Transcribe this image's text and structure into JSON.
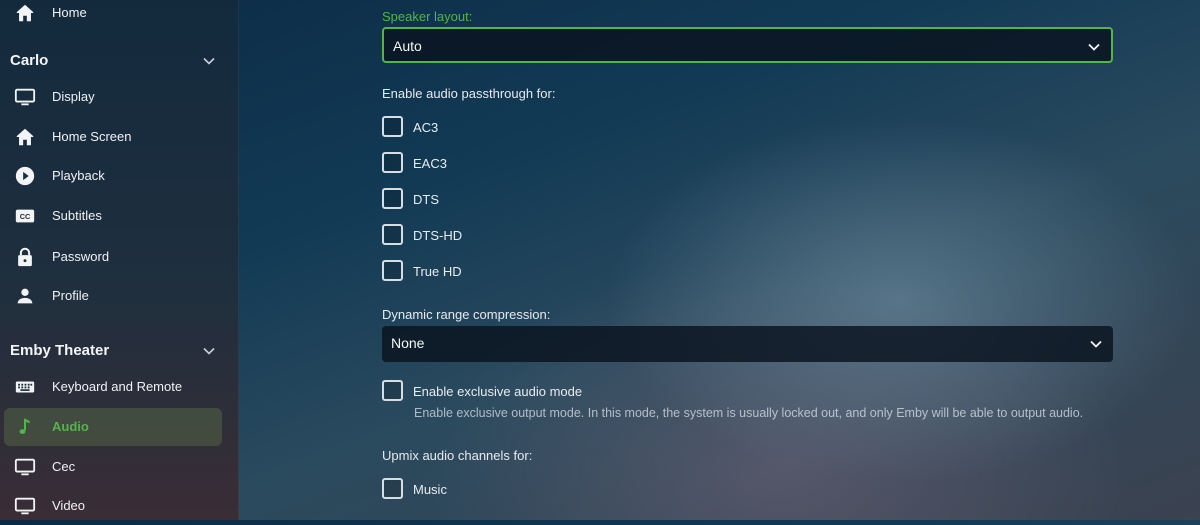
{
  "sidebar": {
    "home_label": "Home",
    "user_section": {
      "title": "Carlo",
      "items": [
        {
          "label": "Display",
          "icon": "monitor-icon"
        },
        {
          "label": "Home Screen",
          "icon": "home-icon"
        },
        {
          "label": "Playback",
          "icon": "play-circle-icon"
        },
        {
          "label": "Subtitles",
          "icon": "closed-captions-icon"
        },
        {
          "label": "Password",
          "icon": "lock-icon"
        },
        {
          "label": "Profile",
          "icon": "person-icon"
        }
      ]
    },
    "app_section": {
      "title": "Emby Theater",
      "items": [
        {
          "label": "Keyboard and Remote",
          "icon": "keyboard-icon"
        },
        {
          "label": "Audio",
          "icon": "music-note-icon",
          "active": true
        },
        {
          "label": "Cec",
          "icon": "monitor-icon"
        },
        {
          "label": "Video",
          "icon": "monitor-icon"
        }
      ]
    }
  },
  "main": {
    "speaker_layout": {
      "label": "Speaker layout:",
      "value": "Auto"
    },
    "passthrough": {
      "label": "Enable audio passthrough for:",
      "options": [
        {
          "label": "AC3",
          "checked": false
        },
        {
          "label": "EAC3",
          "checked": false
        },
        {
          "label": "DTS",
          "checked": false
        },
        {
          "label": "DTS-HD",
          "checked": false
        },
        {
          "label": "True HD",
          "checked": false
        }
      ]
    },
    "drc": {
      "label": "Dynamic range compression:",
      "value": "None"
    },
    "exclusive": {
      "label": "Enable exclusive audio mode",
      "checked": false,
      "description": "Enable exclusive output mode. In this mode, the system is usually locked out, and only Emby will be able to output audio."
    },
    "upmix": {
      "label": "Upmix audio channels for:",
      "options": [
        {
          "label": "Music",
          "checked": false
        }
      ]
    }
  },
  "colors": {
    "accent": "#52b54b",
    "active_bg": "#4b5a3a"
  }
}
